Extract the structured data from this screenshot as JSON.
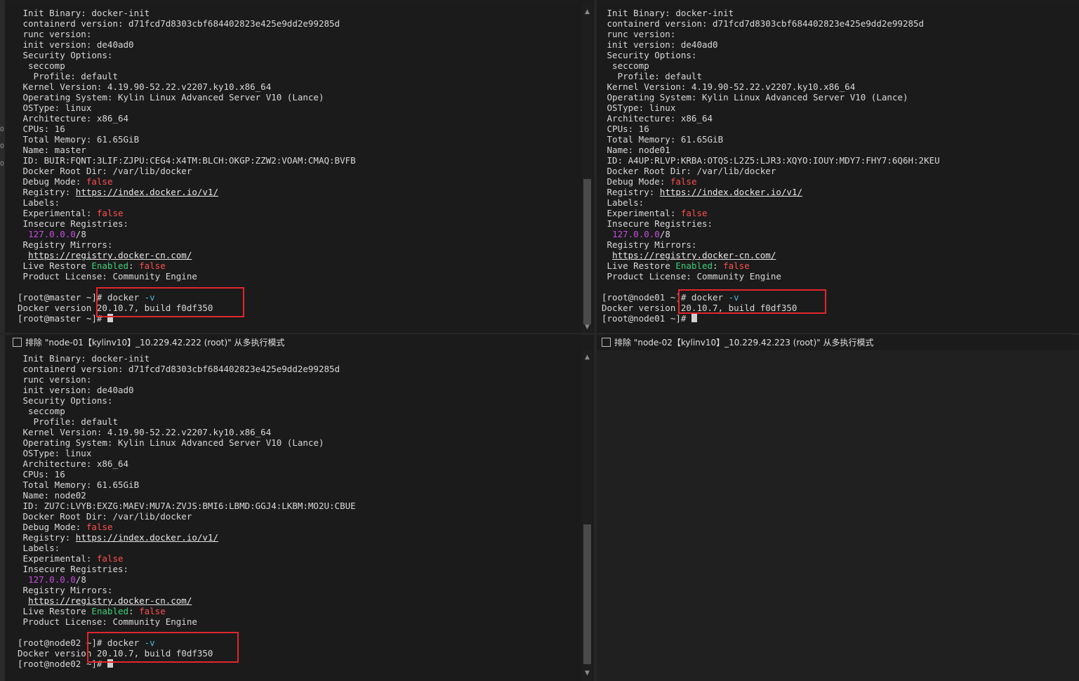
{
  "panes": [
    {
      "id": "master",
      "lines": [
        [
          {
            "t": " Init Binary: docker-init"
          }
        ],
        [
          {
            "t": " containerd version: d71fcd7d8303cbf684402823e425e9dd2e99285d"
          }
        ],
        [
          {
            "t": " runc version:"
          }
        ],
        [
          {
            "t": " init version: de40ad0"
          }
        ],
        [
          {
            "t": " Security Options:"
          }
        ],
        [
          {
            "t": "  seccomp"
          }
        ],
        [
          {
            "t": "   Profile: default"
          }
        ],
        [
          {
            "t": " Kernel Version: 4.19.90-52.22.v2207.ky10.x86_64"
          }
        ],
        [
          {
            "t": " Operating System: Kylin Linux Advanced Server V10 (Lance)"
          }
        ],
        [
          {
            "t": " OSType: linux"
          }
        ],
        [
          {
            "t": " Architecture: x86_64"
          }
        ],
        [
          {
            "t": " CPUs: 16"
          }
        ],
        [
          {
            "t": " Total Memory: 61.65GiB"
          }
        ],
        [
          {
            "t": " Name: master"
          }
        ],
        [
          {
            "t": " ID: BUIR:FQNT:3LIF:ZJPU:CEG4:X4TM:BLCH:OKGP:ZZW2:VOAM:CMAQ:BVFB"
          }
        ],
        [
          {
            "t": " Docker Root Dir: /var/lib/docker"
          }
        ],
        [
          {
            "t": " Debug Mode: "
          },
          {
            "t": "false",
            "c": "red"
          }
        ],
        [
          {
            "t": " Registry: "
          },
          {
            "t": "https://index.docker.io/v1/",
            "c": "link"
          }
        ],
        [
          {
            "t": " Labels:"
          }
        ],
        [
          {
            "t": " Experimental: "
          },
          {
            "t": "false",
            "c": "red"
          }
        ],
        [
          {
            "t": " Insecure Registries:"
          }
        ],
        [
          {
            "t": "  "
          },
          {
            "t": "127.0.0.0",
            "c": "mag"
          },
          {
            "t": "/8"
          }
        ],
        [
          {
            "t": " Registry Mirrors:"
          }
        ],
        [
          {
            "t": "  "
          },
          {
            "t": "https://registry.docker-cn.com/",
            "c": "link"
          }
        ],
        [
          {
            "t": " Live Restore "
          },
          {
            "t": "Enabled",
            "c": "grn"
          },
          {
            "t": ": "
          },
          {
            "t": "false",
            "c": "red"
          }
        ],
        [
          {
            "t": " Product License: Community Engine"
          }
        ],
        [
          {
            "t": ""
          }
        ],
        [
          {
            "t": "[root@master ~]# docker "
          },
          {
            "t": "-v",
            "c": "cyn"
          }
        ],
        [
          {
            "t": "Docker version 20.10.7, build f0df350"
          }
        ],
        [
          {
            "t": "[root@master ~]# "
          },
          {
            "cursor": true
          }
        ]
      ]
    },
    {
      "id": "node01",
      "lines": [
        [
          {
            "t": " Init Binary: docker-init"
          }
        ],
        [
          {
            "t": " containerd version: d71fcd7d8303cbf684402823e425e9dd2e99285d"
          }
        ],
        [
          {
            "t": " runc version:"
          }
        ],
        [
          {
            "t": " init version: de40ad0"
          }
        ],
        [
          {
            "t": " Security Options:"
          }
        ],
        [
          {
            "t": "  seccomp"
          }
        ],
        [
          {
            "t": "   Profile: default"
          }
        ],
        [
          {
            "t": " Kernel Version: 4.19.90-52.22.v2207.ky10.x86_64"
          }
        ],
        [
          {
            "t": " Operating System: Kylin Linux Advanced Server V10 (Lance)"
          }
        ],
        [
          {
            "t": " OSType: linux"
          }
        ],
        [
          {
            "t": " Architecture: x86_64"
          }
        ],
        [
          {
            "t": " CPUs: 16"
          }
        ],
        [
          {
            "t": " Total Memory: 61.65GiB"
          }
        ],
        [
          {
            "t": " Name: node01"
          }
        ],
        [
          {
            "t": " ID: A4UP:RLVP:KRBA:OTQS:L2Z5:LJR3:XQYO:IOUY:MDY7:FHY7:6Q6H:2KEU"
          }
        ],
        [
          {
            "t": " Docker Root Dir: /var/lib/docker"
          }
        ],
        [
          {
            "t": " Debug Mode: "
          },
          {
            "t": "false",
            "c": "red"
          }
        ],
        [
          {
            "t": " Registry: "
          },
          {
            "t": "https://index.docker.io/v1/",
            "c": "link"
          }
        ],
        [
          {
            "t": " Labels:"
          }
        ],
        [
          {
            "t": " Experimental: "
          },
          {
            "t": "false",
            "c": "red"
          }
        ],
        [
          {
            "t": " Insecure Registries:"
          }
        ],
        [
          {
            "t": "  "
          },
          {
            "t": "127.0.0.0",
            "c": "mag"
          },
          {
            "t": "/8"
          }
        ],
        [
          {
            "t": " Registry Mirrors:"
          }
        ],
        [
          {
            "t": "  "
          },
          {
            "t": "https://registry.docker-cn.com/",
            "c": "link"
          }
        ],
        [
          {
            "t": " Live Restore "
          },
          {
            "t": "Enabled",
            "c": "grn"
          },
          {
            "t": ": "
          },
          {
            "t": "false",
            "c": "red"
          }
        ],
        [
          {
            "t": " Product License: Community Engine"
          }
        ],
        [
          {
            "t": ""
          }
        ],
        [
          {
            "t": "[root@node01 ~]# docker "
          },
          {
            "t": "-v",
            "c": "cyn"
          }
        ],
        [
          {
            "t": "Docker version 20.10.7, build f0df350"
          }
        ],
        [
          {
            "t": "[root@node01 ~]# "
          },
          {
            "cursor": true
          }
        ]
      ]
    },
    {
      "id": "node02",
      "lines": [
        [
          {
            "t": " Init Binary: docker-init"
          }
        ],
        [
          {
            "t": " containerd version: d71fcd7d8303cbf684402823e425e9dd2e99285d"
          }
        ],
        [
          {
            "t": " runc version:"
          }
        ],
        [
          {
            "t": " init version: de40ad0"
          }
        ],
        [
          {
            "t": " Security Options:"
          }
        ],
        [
          {
            "t": "  seccomp"
          }
        ],
        [
          {
            "t": "   Profile: default"
          }
        ],
        [
          {
            "t": " Kernel Version: 4.19.90-52.22.v2207.ky10.x86_64"
          }
        ],
        [
          {
            "t": " Operating System: Kylin Linux Advanced Server V10 (Lance)"
          }
        ],
        [
          {
            "t": " OSType: linux"
          }
        ],
        [
          {
            "t": " Architecture: x86_64"
          }
        ],
        [
          {
            "t": " CPUs: 16"
          }
        ],
        [
          {
            "t": " Total Memory: 61.65GiB"
          }
        ],
        [
          {
            "t": " Name: node02"
          }
        ],
        [
          {
            "t": " ID: ZU7C:LVYB:EXZG:MAEV:MU7A:ZVJS:BMI6:LBMD:GGJ4:LKBM:MO2U:CBUE"
          }
        ],
        [
          {
            "t": " Docker Root Dir: /var/lib/docker"
          }
        ],
        [
          {
            "t": " Debug Mode: "
          },
          {
            "t": "false",
            "c": "red"
          }
        ],
        [
          {
            "t": " Registry: "
          },
          {
            "t": "https://index.docker.io/v1/",
            "c": "link"
          }
        ],
        [
          {
            "t": " Labels:"
          }
        ],
        [
          {
            "t": " Experimental: "
          },
          {
            "t": "false",
            "c": "red"
          }
        ],
        [
          {
            "t": " Insecure Registries:"
          }
        ],
        [
          {
            "t": "  "
          },
          {
            "t": "127.0.0.0",
            "c": "mag"
          },
          {
            "t": "/8"
          }
        ],
        [
          {
            "t": " Registry Mirrors:"
          }
        ],
        [
          {
            "t": "  "
          },
          {
            "t": "https://registry.docker-cn.com/",
            "c": "link"
          }
        ],
        [
          {
            "t": " Live Restore "
          },
          {
            "t": "Enabled",
            "c": "grn"
          },
          {
            "t": ": "
          },
          {
            "t": "false",
            "c": "red"
          }
        ],
        [
          {
            "t": " Product License: Community Engine"
          }
        ],
        [
          {
            "t": ""
          }
        ],
        [
          {
            "t": "[root@node02 ~]# docker "
          },
          {
            "t": "-v",
            "c": "cyn"
          }
        ],
        [
          {
            "t": "Docker version 20.10.7, build f0df350"
          }
        ],
        [
          {
            "t": "[root@node02 ~]# "
          },
          {
            "cursor": true
          }
        ]
      ]
    }
  ],
  "exclude_bars": {
    "node01": "排除 \"node-01【kylinv10】_10.229.42.222 (root)\" 从多执行模式",
    "node02": "排除 \"node-02【kylinv10】_10.229.42.223 (root)\" 从多执行模式"
  },
  "left_edge_digits": [
    "0",
    "0",
    "0"
  ],
  "scroll": {
    "up": "▲",
    "down": "▼"
  },
  "colors": {
    "error_red": "#ff4f4f",
    "enabled_green": "#3fce7a",
    "ip_magenta": "#c74be0",
    "flag_cyan": "#4fb8d8",
    "highlight_box": "#e0262d"
  }
}
